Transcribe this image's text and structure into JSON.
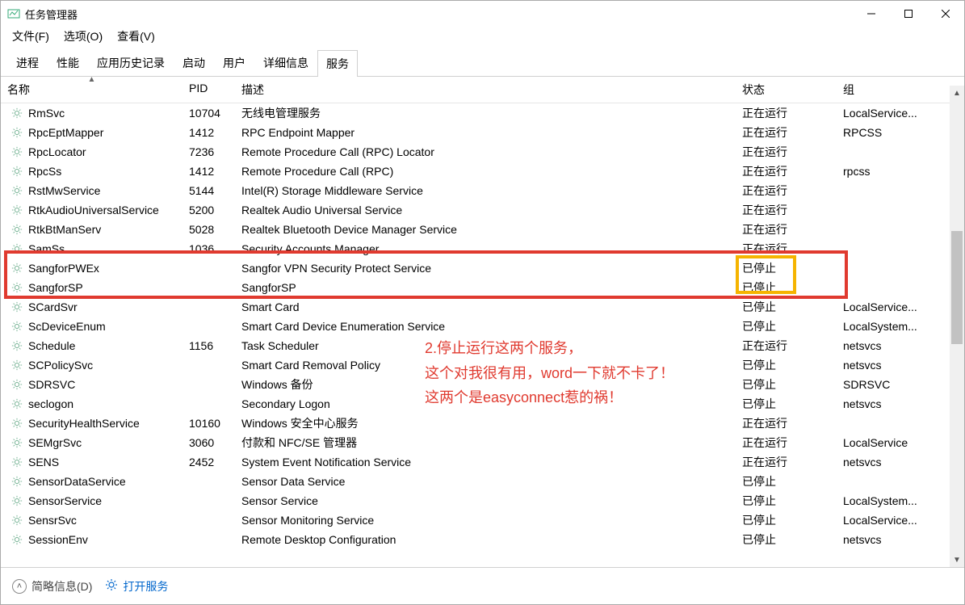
{
  "window": {
    "title": "任务管理器",
    "menu": {
      "file": "文件(F)",
      "options": "选项(O)",
      "view": "查看(V)"
    }
  },
  "tabs": {
    "items": [
      "进程",
      "性能",
      "应用历史记录",
      "启动",
      "用户",
      "详细信息",
      "服务"
    ],
    "active_index": 6
  },
  "columns": {
    "name": "名称",
    "pid": "PID",
    "desc": "描述",
    "state": "状态",
    "group": "组"
  },
  "status": {
    "running": "正在运行",
    "stopped": "已停止"
  },
  "services": [
    {
      "name": "RmSvc",
      "pid": "10704",
      "desc": "无线电管理服务",
      "state": "正在运行",
      "group": "LocalService..."
    },
    {
      "name": "RpcEptMapper",
      "pid": "1412",
      "desc": "RPC Endpoint Mapper",
      "state": "正在运行",
      "group": "RPCSS"
    },
    {
      "name": "RpcLocator",
      "pid": "7236",
      "desc": "Remote Procedure Call (RPC) Locator",
      "state": "正在运行",
      "group": ""
    },
    {
      "name": "RpcSs",
      "pid": "1412",
      "desc": "Remote Procedure Call (RPC)",
      "state": "正在运行",
      "group": "rpcss"
    },
    {
      "name": "RstMwService",
      "pid": "5144",
      "desc": "Intel(R) Storage Middleware Service",
      "state": "正在运行",
      "group": ""
    },
    {
      "name": "RtkAudioUniversalService",
      "pid": "5200",
      "desc": "Realtek Audio Universal Service",
      "state": "正在运行",
      "group": ""
    },
    {
      "name": "RtkBtManServ",
      "pid": "5028",
      "desc": "Realtek Bluetooth Device Manager Service",
      "state": "正在运行",
      "group": ""
    },
    {
      "name": "SamSs",
      "pid": "1036",
      "desc": "Security Accounts Manager",
      "state": "正在运行",
      "group": ""
    },
    {
      "name": "SangforPWEx",
      "pid": "",
      "desc": "Sangfor VPN Security Protect Service",
      "state": "已停止",
      "group": ""
    },
    {
      "name": "SangforSP",
      "pid": "",
      "desc": "SangforSP",
      "state": "已停止",
      "group": ""
    },
    {
      "name": "SCardSvr",
      "pid": "",
      "desc": "Smart Card",
      "state": "已停止",
      "group": "LocalService..."
    },
    {
      "name": "ScDeviceEnum",
      "pid": "",
      "desc": "Smart Card Device Enumeration Service",
      "state": "已停止",
      "group": "LocalSystem..."
    },
    {
      "name": "Schedule",
      "pid": "1156",
      "desc": "Task Scheduler",
      "state": "正在运行",
      "group": "netsvcs"
    },
    {
      "name": "SCPolicySvc",
      "pid": "",
      "desc": "Smart Card Removal Policy",
      "state": "已停止",
      "group": "netsvcs"
    },
    {
      "name": "SDRSVC",
      "pid": "",
      "desc": "Windows 备份",
      "state": "已停止",
      "group": "SDRSVC"
    },
    {
      "name": "seclogon",
      "pid": "",
      "desc": "Secondary Logon",
      "state": "已停止",
      "group": "netsvcs"
    },
    {
      "name": "SecurityHealthService",
      "pid": "10160",
      "desc": "Windows 安全中心服务",
      "state": "正在运行",
      "group": ""
    },
    {
      "name": "SEMgrSvc",
      "pid": "3060",
      "desc": "付款和 NFC/SE 管理器",
      "state": "正在运行",
      "group": "LocalService"
    },
    {
      "name": "SENS",
      "pid": "2452",
      "desc": "System Event Notification Service",
      "state": "正在运行",
      "group": "netsvcs"
    },
    {
      "name": "SensorDataService",
      "pid": "",
      "desc": "Sensor Data Service",
      "state": "已停止",
      "group": ""
    },
    {
      "name": "SensorService",
      "pid": "",
      "desc": "Sensor Service",
      "state": "已停止",
      "group": "LocalSystem..."
    },
    {
      "name": "SensrSvc",
      "pid": "",
      "desc": "Sensor Monitoring Service",
      "state": "已停止",
      "group": "LocalService..."
    },
    {
      "name": "SessionEnv",
      "pid": "",
      "desc": "Remote Desktop Configuration",
      "state": "已停止",
      "group": "netsvcs"
    }
  ],
  "footer": {
    "brief": "简略信息(D)",
    "open_services": "打开服务"
  },
  "annotation": {
    "line1": "2.停止运行这两个服务，",
    "line2": "这个对我很有用，word一下就不卡了！",
    "line3": "这两个是easyconnect惹的祸！"
  }
}
